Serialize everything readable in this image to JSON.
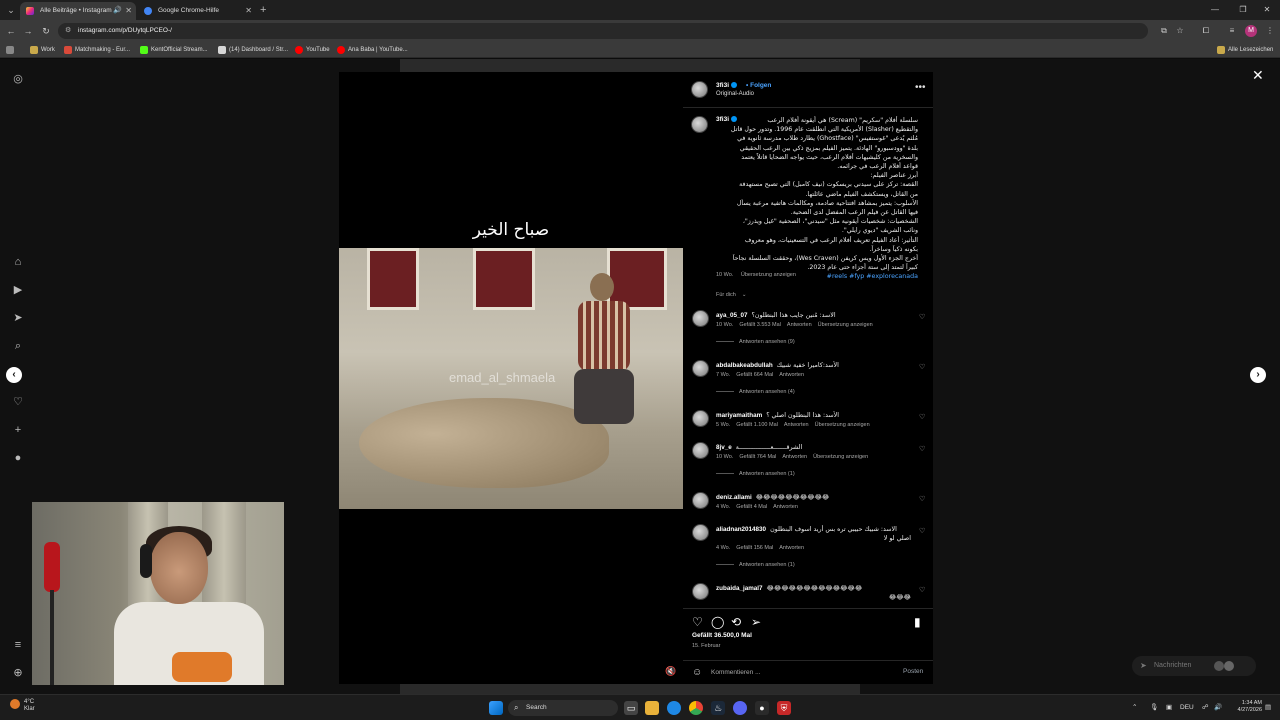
{
  "browser": {
    "tabs": [
      {
        "title": "Alle Beiträge • Instagram",
        "active": true
      },
      {
        "title": "Google Chrome-Hilfe",
        "active": false
      }
    ],
    "url": "instagram.com/p/DUytqLPCEO-/",
    "profile_initial": "M",
    "bookmarks": [
      "Work",
      "Matchmaking - Eur...",
      "KentOfficial Stream...",
      "(14) Dashboard / Str...",
      "YouTube",
      "Ana Baba | YouTube..."
    ],
    "bookmarks_right": "Alle Lesezeichen"
  },
  "post": {
    "video_caption": "صباح الخير",
    "watermark": "emad_al_shmaela",
    "username": "3fi3i",
    "follow_label": "Folgen",
    "audio": "Original-Audio",
    "caption_lines": [
      "سلسلة أفلام \"سكريم\" (Scream) هي أيقونة أفلام الرعب",
      "والتقطيع (Slasher) الأمريكية التي انطلقت عام 1996. وتدور حول قاتل",
      "مُلثم يُدعى \"غوستفيس\" (Ghostface) يطارد طلاب مدرسة ثانوية في",
      "بلدة \"وودسبورو\" الهادئة. يتميز الفيلم بمزيج ذكي بين الرعب الحقيقي",
      "والسخرية من كليشيهات أفلام الرعب، حيث يواجه الضحايا قاتلاً يعتمد",
      "قواعد أفلام الرعب في جرائمه.",
      "أبرز عناصر الفيلم:",
      "القصة: تركز على سيدني بريسكوت (نيف كامبل) التي تصبح مستهدفة",
      "من القاتل، ويستكشف الفيلم ماضي عائلتها.",
      "الأسلوب: يتميز بمشاهد افتتاحية صادمة، ومكالمات هاتفية مرعبة يسأل",
      "فيها القاتل عن فيلم الرعب المفضل لدى الضحية.",
      "الشخصيات: شخصيات أيقونية مثل \"سيدني\"، الصحفية \"غيل ويذرز\"،",
      "ونائب الشريف \"ديوي رايلي\".",
      "التأثير: أعاد الفيلم تعريف أفلام الرعب في التسعينيات، وهو معروف",
      "بكونه ذكياً وساخراً.",
      "أخرج الجزء الأول ويس كريفن (Wes Craven)، وحققت السلسلة نجاحاً",
      "كبيراً لتمتد إلى ستة أجزاء حتى عام 2023."
    ],
    "hashtags": "reels #fyp #explorecanada#",
    "caption_age": "10 Wo.",
    "translate_label": "Übersetzung anzeigen",
    "filter_label": "Für dich",
    "comments": [
      {
        "user": "aya_05_07",
        "text": "الاسد: مُنين جايب هذا البنطلون؟",
        "age": "10 Wo.",
        "likes": "Gefällt 3.553 Mal",
        "reply": "Antworten",
        "translate": "Übersetzung anzeigen",
        "replies": "Antworten ansehen (9)"
      },
      {
        "user": "abdalbakeabdullah",
        "text": "الأسد:كاميرا خفية شبيك",
        "age": "7 Wo.",
        "likes": "Gefällt 664 Mal",
        "reply": "Antworten",
        "translate": "",
        "replies": "Antworten ansehen (4)"
      },
      {
        "user": "mariyamaitham",
        "text": "الأسد: هذا البنطلون اصلي ؟",
        "age": "5 Wo.",
        "likes": "Gefällt 1.100 Mal",
        "reply": "Antworten",
        "translate": "Übersetzung anzeigen",
        "replies": ""
      },
      {
        "user": "8jv_e",
        "text": "الشرقـــــــعـــــــــــــــــة",
        "age": "10 Wo.",
        "likes": "Gefällt 764 Mal",
        "reply": "Antworten",
        "translate": "Übersetzung anzeigen",
        "replies": "Antworten ansehen (1)"
      },
      {
        "user": "deniz.allami",
        "text": "😂😂😂😂😂😂😂😂😂😂",
        "age": "4 Wo.",
        "likes": "Gefällt 4 Mal",
        "reply": "Antworten",
        "translate": "",
        "replies": ""
      },
      {
        "user": "aliadnan2014830",
        "text": "الاسد: شبيك حبيبي تره بس أريد اسوف البنطلون",
        "text2": "اصلي لو لا",
        "age": "4 Wo.",
        "likes": "Gefällt 156 Mal",
        "reply": "Antworten",
        "translate": "",
        "replies": "Antworten ansehen (1)"
      },
      {
        "user": "zubaida_jamal7",
        "text": "😂😂😂😂😂😂😂😂😂😂😂😂😂",
        "text2": "😂😂😂",
        "age": "",
        "likes": "",
        "reply": "",
        "translate": "",
        "replies": ""
      }
    ],
    "likes_total": "Gefällt 36.500,0 Mal",
    "date": "15. Februar",
    "comment_placeholder": "Kommentieren ...",
    "post_label": "Posten"
  },
  "messages_label": "Nachrichten",
  "taskbar": {
    "weather_temp": "4°C",
    "weather_desc": "Klar",
    "search_label": "Search",
    "lang": "DEU",
    "time": "1:34 AM",
    "date": "4/27/2026"
  }
}
